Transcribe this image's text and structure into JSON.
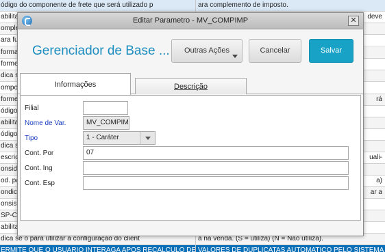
{
  "background": {
    "rows": [
      {
        "c1": "ódigo do componente de frete que será utilizado p",
        "c2": "ara complemento de imposto."
      },
      {
        "c1": "abilita",
        "c2": "deve"
      },
      {
        "c1": "omple",
        "c2": ""
      },
      {
        "c1": "ara fu",
        "c2": ""
      },
      {
        "c1": "forma",
        "c2": ""
      },
      {
        "c1": "forme",
        "c2": ""
      },
      {
        "c1": "dica s",
        "c2": ""
      },
      {
        "c1": "ompor",
        "c2": ""
      },
      {
        "c1": "forme",
        "c2": "rá"
      },
      {
        "c1": "ódigo",
        "c2": ""
      },
      {
        "c1": "abilita",
        "c2": ""
      },
      {
        "c1": "ódigo",
        "c2": ""
      },
      {
        "c1": "dica s",
        "c2": ""
      },
      {
        "c1": "escric",
        "c2": "uali-"
      },
      {
        "c1": "onside",
        "c2": ""
      },
      {
        "c1": "od. pa",
        "c2": "a)"
      },
      {
        "c1": "ondica",
        "c2": "ar a"
      },
      {
        "c1": "onsist",
        "c2": ""
      },
      {
        "c1": "SP-Co",
        "c2": ""
      },
      {
        "c1": "abilita",
        "c2": ""
      },
      {
        "c1": "dica se o para utilizar a configuração do client",
        "c2": "a na venda. (S = utiliza) (N = Não utiliza)."
      },
      {
        "c1": "ERMITE QUE O USUARIO INTERAGA APOS RECALCULO DE",
        "c2": "VALORES DE DUPLICATAS AUTOMATICO PELO SISTEMA"
      }
    ]
  },
  "dialog": {
    "title": "Editar Parametro - MV_COMPIMP",
    "heading": "Gerenciador de Base ...",
    "buttons": {
      "more_actions": "Outras Ações",
      "cancel": "Cancelar",
      "save": "Salvar"
    },
    "tabs": {
      "info": "Informações",
      "description": "Descrição"
    },
    "fields": {
      "filial": {
        "label": "Filial",
        "value": ""
      },
      "nome_var": {
        "label": "Nome de Var.",
        "value": "MV_COMPIMP"
      },
      "tipo": {
        "label": "Tipo",
        "value": "1 - Caráter"
      },
      "cont_por": {
        "label": "Cont. Por",
        "value": "07"
      },
      "cont_ing": {
        "label": "Cont. Ing",
        "value": ""
      },
      "cont_esp": {
        "label": "Cont. Esp",
        "value": ""
      }
    }
  },
  "colors": {
    "accent": "#17a2c6",
    "heading": "#1c8dbf",
    "link_label": "#1a3fbf"
  }
}
